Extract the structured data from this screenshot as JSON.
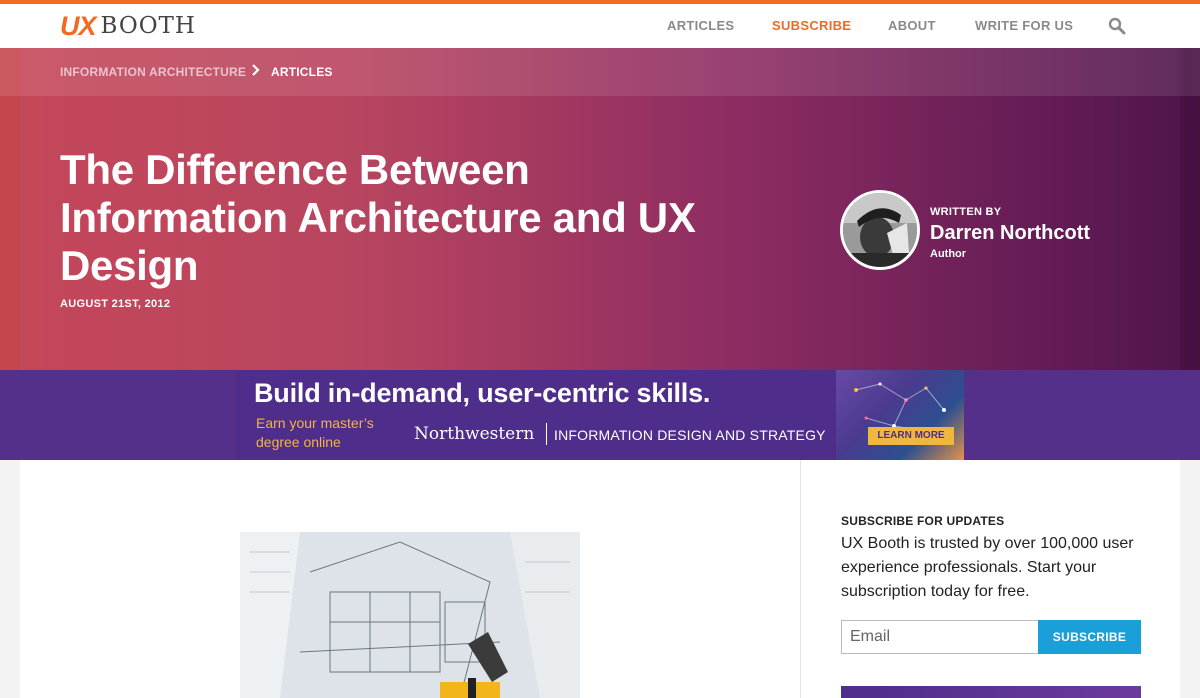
{
  "header": {
    "logo_primary": "UX",
    "logo_secondary": "BOOTH",
    "nav": [
      {
        "label": "ARTICLES"
      },
      {
        "label": "SUBSCRIBE"
      },
      {
        "label": "ABOUT"
      },
      {
        "label": "WRITE FOR US"
      }
    ],
    "accent_color": "#f26a21"
  },
  "breadcrumb": {
    "items": [
      {
        "label": "INFORMATION ARCHITECTURE"
      },
      {
        "label": "ARTICLES"
      }
    ]
  },
  "article": {
    "title": "The Difference Between Information Architecture and UX Design",
    "date": "AUGUST 21ST, 2012"
  },
  "author": {
    "written_by": "WRITTEN BY",
    "name": "Darren Northcott",
    "role": "Author"
  },
  "ad": {
    "headline": "Build in-demand, user-centric skills.",
    "subline": "Earn your master’s degree online",
    "school": "Northwestern",
    "program": "INFORMATION DESIGN AND STRATEGY",
    "cta": "LEARN MORE"
  },
  "sidebar": {
    "heading": "SUBSCRIBE FOR UPDATES",
    "text": "UX Booth is trusted by over 100,000 user experience professionals. Start your subscription today for free.",
    "email_placeholder": "Email",
    "button_label": "SUBSCRIBE",
    "button_color": "#1a9fd8"
  }
}
